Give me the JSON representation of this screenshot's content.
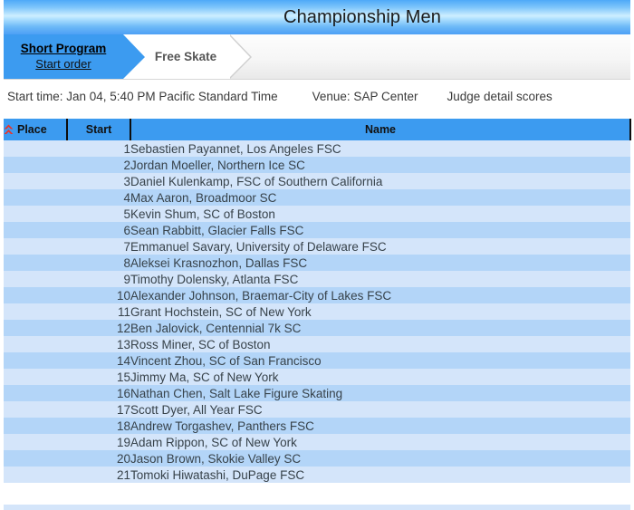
{
  "page": {
    "title": "Championship Men"
  },
  "tabs": [
    {
      "id": "short-program",
      "label": "Short Program",
      "sublabel": "Start order",
      "active": true
    },
    {
      "id": "free-skate",
      "label": "Free Skate",
      "sublabel": "",
      "active": false
    }
  ],
  "info": {
    "start_time": "Start time: Jan 04, 5:40 PM Pacific Standard Time",
    "venue": "Venue: SAP Center",
    "judge_scores_link": "Judge detail scores"
  },
  "table": {
    "sort_icon": "sort-ascending-icon",
    "sorted_column": "Place",
    "columns": [
      {
        "key": "place",
        "label": "Place"
      },
      {
        "key": "start",
        "label": "Start"
      },
      {
        "key": "name",
        "label": "Name"
      }
    ],
    "rows": [
      {
        "place": "",
        "start": "1",
        "name": "Sebastien Payannet, Los Angeles FSC"
      },
      {
        "place": "",
        "start": "2",
        "name": "Jordan Moeller, Northern Ice SC"
      },
      {
        "place": "",
        "start": "3",
        "name": "Daniel Kulenkamp, FSC of Southern California"
      },
      {
        "place": "",
        "start": "4",
        "name": "Max Aaron, Broadmoor SC"
      },
      {
        "place": "",
        "start": "5",
        "name": "Kevin Shum, SC of Boston"
      },
      {
        "place": "",
        "start": "6",
        "name": "Sean Rabbitt, Glacier Falls FSC"
      },
      {
        "place": "",
        "start": "7",
        "name": "Emmanuel Savary, University of Delaware FSC"
      },
      {
        "place": "",
        "start": "8",
        "name": "Aleksei Krasnozhon, Dallas FSC"
      },
      {
        "place": "",
        "start": "9",
        "name": "Timothy Dolensky, Atlanta FSC"
      },
      {
        "place": "",
        "start": "10",
        "name": "Alexander Johnson, Braemar-City of Lakes FSC"
      },
      {
        "place": "",
        "start": "11",
        "name": "Grant Hochstein, SC of New York"
      },
      {
        "place": "",
        "start": "12",
        "name": "Ben Jalovick, Centennial 7k SC"
      },
      {
        "place": "",
        "start": "13",
        "name": "Ross Miner, SC of Boston"
      },
      {
        "place": "",
        "start": "14",
        "name": "Vincent Zhou, SC of San Francisco"
      },
      {
        "place": "",
        "start": "15",
        "name": "Jimmy Ma, SC of New York"
      },
      {
        "place": "",
        "start": "16",
        "name": "Nathan Chen, Salt Lake Figure Skating"
      },
      {
        "place": "",
        "start": "17",
        "name": "Scott Dyer, All Year FSC"
      },
      {
        "place": "",
        "start": "18",
        "name": "Andrew Torgashev, Panthers FSC"
      },
      {
        "place": "",
        "start": "19",
        "name": "Adam Rippon, SC of New York"
      },
      {
        "place": "",
        "start": "20",
        "name": "Jason Brown, Skokie Valley SC"
      },
      {
        "place": "",
        "start": "21",
        "name": "Tomoki Hiwatashi, DuPage FSC"
      }
    ]
  },
  "colors": {
    "header_blue": "#3c9bf0",
    "row_odd": "#d4e5fa",
    "row_even": "#b3d5f8",
    "sort_icon_red": "#e8352b",
    "title_text": "#1b1b1b"
  }
}
